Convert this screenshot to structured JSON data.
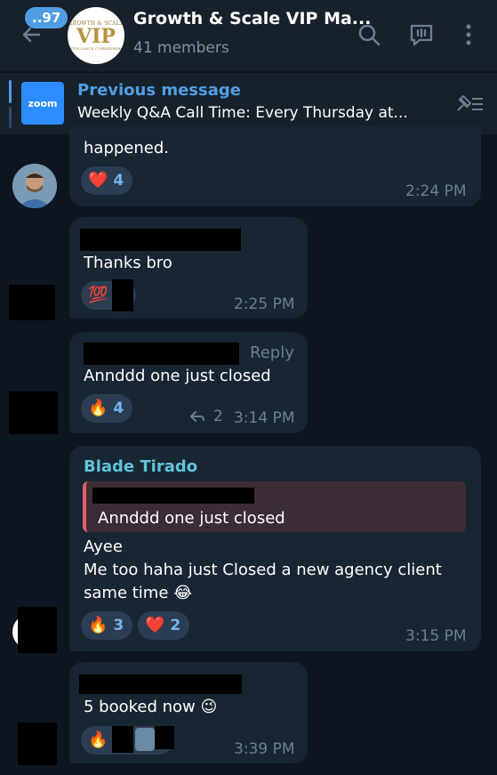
{
  "header": {
    "unread_count": "..97",
    "title": "Growth & Scale VIP Ma...",
    "subtitle": "41 members",
    "logo": {
      "top": "GROWTH & SCALE",
      "mid": "VIP",
      "bottom": "WITH LANCE C GREENBERG"
    },
    "icons": [
      "back-arrow-icon",
      "search-icon",
      "voice-chat-icon",
      "more-vertical-icon"
    ]
  },
  "pinned": {
    "title": "Previous message",
    "text": "Weekly Q&A Call Time: Every Thursday at...",
    "thumb_label": "zoom"
  },
  "messages": [
    {
      "text": "happened.",
      "reactions": [
        {
          "emoji": "❤️",
          "count": "4"
        }
      ],
      "time": "2:24 PM"
    },
    {
      "text": "Thanks bro",
      "reactions": [
        {
          "emoji": "💯",
          "count": ""
        }
      ],
      "time": "2:25 PM"
    },
    {
      "reply_label": "Reply",
      "text": "Annddd one just closed",
      "reactions": [
        {
          "emoji": "🔥",
          "count": "4"
        }
      ],
      "replies": "2",
      "time": "3:14 PM"
    },
    {
      "sender": "Blade Tirado",
      "quote": "Annddd one just closed",
      "line1": "Ayee",
      "line2": "Me too haha just Closed a new agency client",
      "line3": "same time",
      "line3_emoji": "😂",
      "reactions": [
        {
          "emoji": "🔥",
          "count": "3"
        },
        {
          "emoji": "❤️",
          "count": "2"
        }
      ],
      "time": "3:15 PM"
    },
    {
      "text": "5 booked now",
      "text_emoji": "😉",
      "reactions": [
        {
          "emoji": "🔥",
          "count": ""
        }
      ],
      "time": "3:39 PM"
    }
  ],
  "colors": {
    "background": "#0e1621",
    "header": "#17212b",
    "bubble": "#182533",
    "accent": "#4f9ee4",
    "reaction_bg": "#2b3d52",
    "sender": "#5fc4d8",
    "quote_bar": "#e55b6e"
  }
}
